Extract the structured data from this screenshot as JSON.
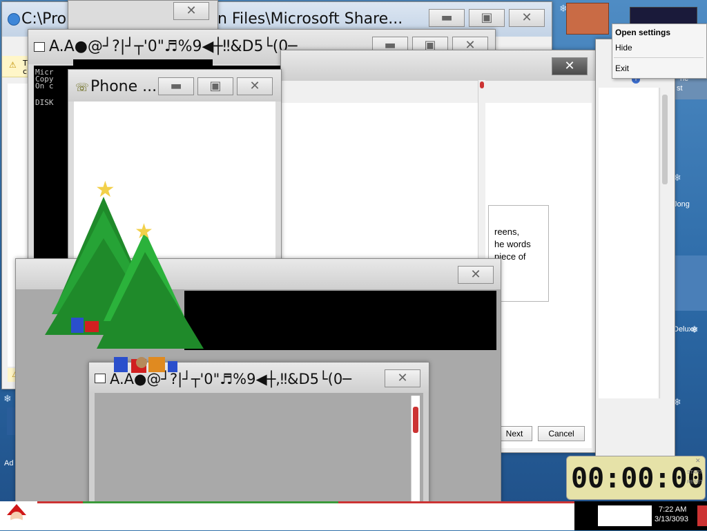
{
  "windows": {
    "explorer": {
      "title": "C:\\Pro",
      "title2": "n Files\\Microsoft Share...",
      "info_text": "T",
      "info_text2": "c"
    },
    "garbled_console": {
      "title": "A.A●@┘?|┘┬'0\"♬%9◀┼‼&D5└(0─",
      "console_lines": [
        "Micr",
        "Copy",
        "On c",
        "",
        "DISK"
      ]
    },
    "phone": {
      "title": "Phone ..."
    },
    "wizard": {
      "text_fragment_1": "reens,",
      "text_fragment_2": "he words",
      "text_fragment_3": "piece of",
      "next_label": "Next",
      "cancel_label": "Cancel"
    },
    "bottom_console": {
      "title": "A.A●@┘?|┘┬'0\"♬%9◀┼,‼&D5└(0─"
    }
  },
  "context_menu": {
    "items": [
      "Open settings",
      "Hide",
      "Exit"
    ]
  },
  "desktop_icons": {
    "right_label_1": "he",
    "right_label_2": "st",
    "right_label_3": "Jong",
    "right_label_4": "Deluxe",
    "left_label": "Ad"
  },
  "timer": {
    "display": "00:00:00",
    "start_label": "START",
    "reset_label": "RESET"
  },
  "taskbar": {
    "time": "7:22 AM",
    "date": "3/13/3093"
  },
  "colors": {
    "desktop": "#2f6fa8",
    "console_bg": "#000000",
    "timer_bg": "#e6e2a8",
    "accent_red": "#cc3333"
  },
  "icons": {
    "santa": "santa-icon",
    "ie": "ie-icon",
    "shield": "shield-icon",
    "phone": "phone-icon"
  }
}
